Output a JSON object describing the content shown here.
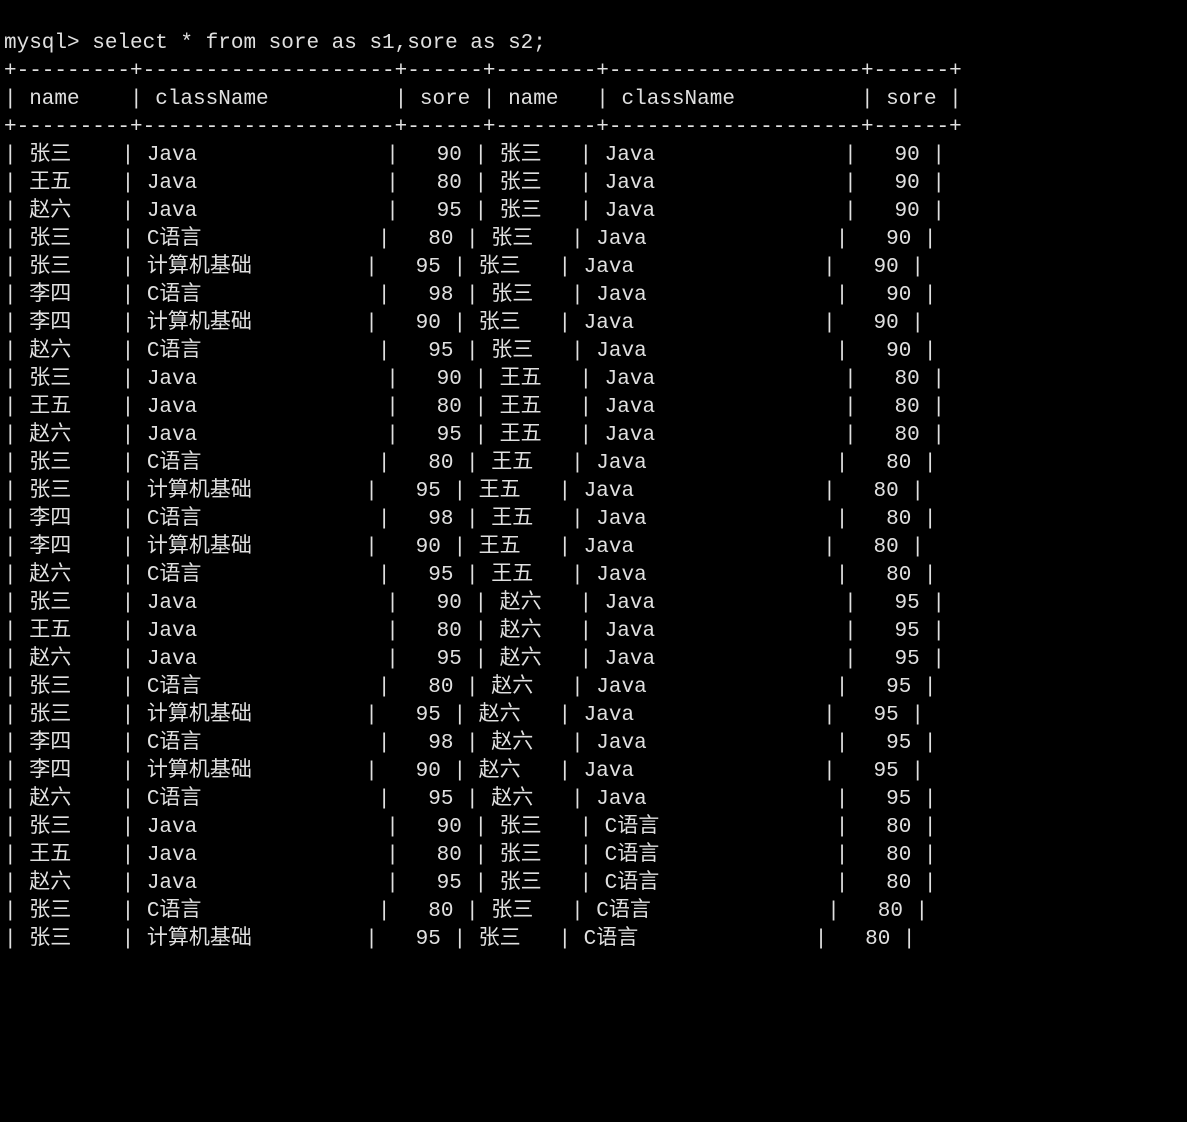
{
  "prompt": "mysql> select * from sore as s1,sore as s2;",
  "border": "+---------+--------------------+------+--------+--------------------+------+",
  "columns": [
    "name",
    "className",
    "sore",
    "name",
    "className",
    "sore"
  ],
  "widths": [
    9,
    20,
    6,
    8,
    20,
    6
  ],
  "aligns": [
    "left",
    "left",
    "right",
    "left",
    "left",
    "right"
  ],
  "s1": [
    {
      "name": "张三",
      "className": "Java",
      "sore": 90
    },
    {
      "name": "王五",
      "className": "Java",
      "sore": 80
    },
    {
      "name": "赵六",
      "className": "Java",
      "sore": 95
    },
    {
      "name": "张三",
      "className": "C语言",
      "sore": 80
    },
    {
      "name": "张三",
      "className": "计算机基础",
      "sore": 95
    },
    {
      "name": "李四",
      "className": "C语言",
      "sore": 98
    },
    {
      "name": "李四",
      "className": "计算机基础",
      "sore": 90
    },
    {
      "name": "赵六",
      "className": "C语言",
      "sore": 95
    }
  ],
  "s2_visible": [
    {
      "name": "张三",
      "className": "Java",
      "sore": 90
    },
    {
      "name": "王五",
      "className": "Java",
      "sore": 80
    },
    {
      "name": "赵六",
      "className": "Java",
      "sore": 95
    },
    {
      "name": "张三",
      "className": "C语言",
      "sore": 80
    }
  ],
  "last_group_cutoff": 5
}
